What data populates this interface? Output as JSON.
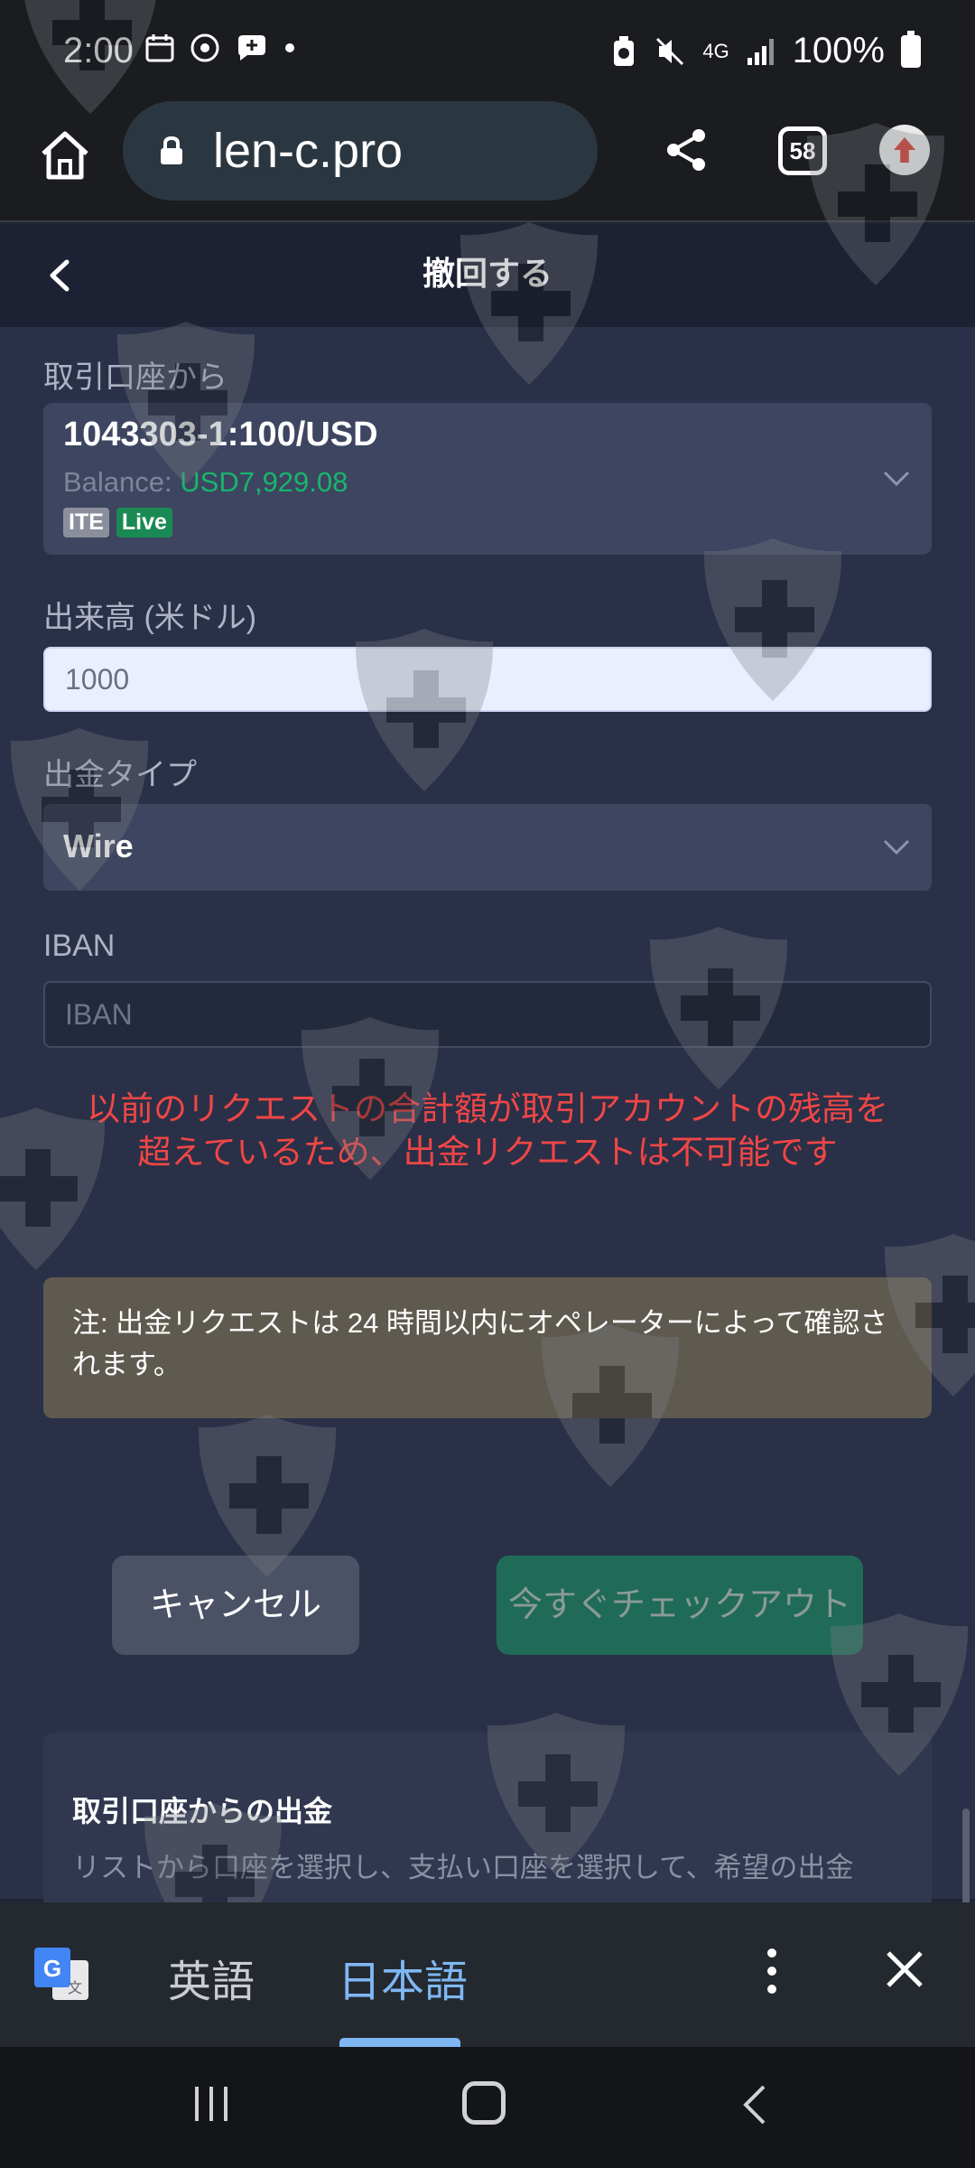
{
  "status_bar": {
    "time": "2:00",
    "battery": "100%",
    "network": "4G"
  },
  "browser": {
    "url": "len-c.pro",
    "tab_count": "58"
  },
  "page": {
    "title": "撤回する"
  },
  "form": {
    "from_account_label": "取引口座から",
    "account_number": "1043303-1:100/USD",
    "balance_label": "Balance:",
    "balance_value": "USD7,929.08",
    "tags": [
      "ITE",
      "Live"
    ],
    "amount_label": "出来高 (米ドル)",
    "amount_value": "1000",
    "withdraw_type_label": "出金タイプ",
    "withdraw_type_value": "Wire",
    "iban_label": "IBAN",
    "iban_placeholder": "IBAN"
  },
  "error": {
    "line1": "以前のリクエストの合計額が取引アカウントの残高を",
    "line2": "超えているため、出金リクエストは不可能です"
  },
  "note": {
    "text": "注: 出金リクエストは 24 時間以内にオペレーターによって確認されます。"
  },
  "actions": {
    "cancel_label": "キャンセル",
    "checkout_label": "今すぐチェックアウト"
  },
  "info": {
    "title": "取引口座からの出金",
    "text": "リストから口座を選択し、支払い口座を選択して、希望の出金"
  },
  "translate_bar": {
    "lang_source": "英語",
    "lang_target": "日本語"
  },
  "colors": {
    "background": "#2a3047",
    "balance_green": "#16b66c",
    "error_red": "#f04646",
    "checkout_green": "#1f6b57",
    "translate_accent": "#7fb7f3"
  }
}
